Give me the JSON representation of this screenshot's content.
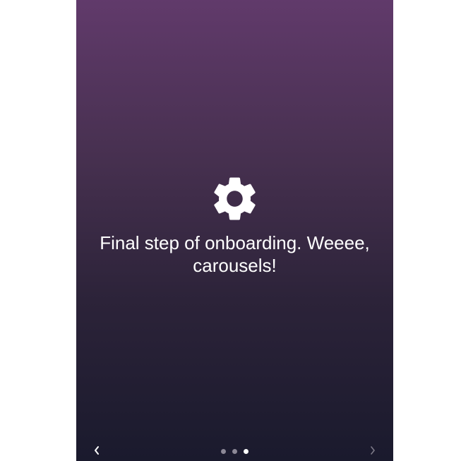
{
  "carousel": {
    "slide": {
      "icon": "gear-icon",
      "message": "Final step of onboarding. Weeee, carousels!"
    },
    "navigation": {
      "prev_icon": "chevron-left-icon",
      "next_icon": "chevron-right-icon",
      "page_count": 3,
      "active_page": 3
    }
  },
  "colors": {
    "gradient_top": "#613a6b",
    "gradient_bottom": "#1a1a2d",
    "text": "#ffffff",
    "dot_inactive": "#8c8896",
    "dot_active": "#ffffff",
    "next_arrow": "#7d7a88"
  }
}
